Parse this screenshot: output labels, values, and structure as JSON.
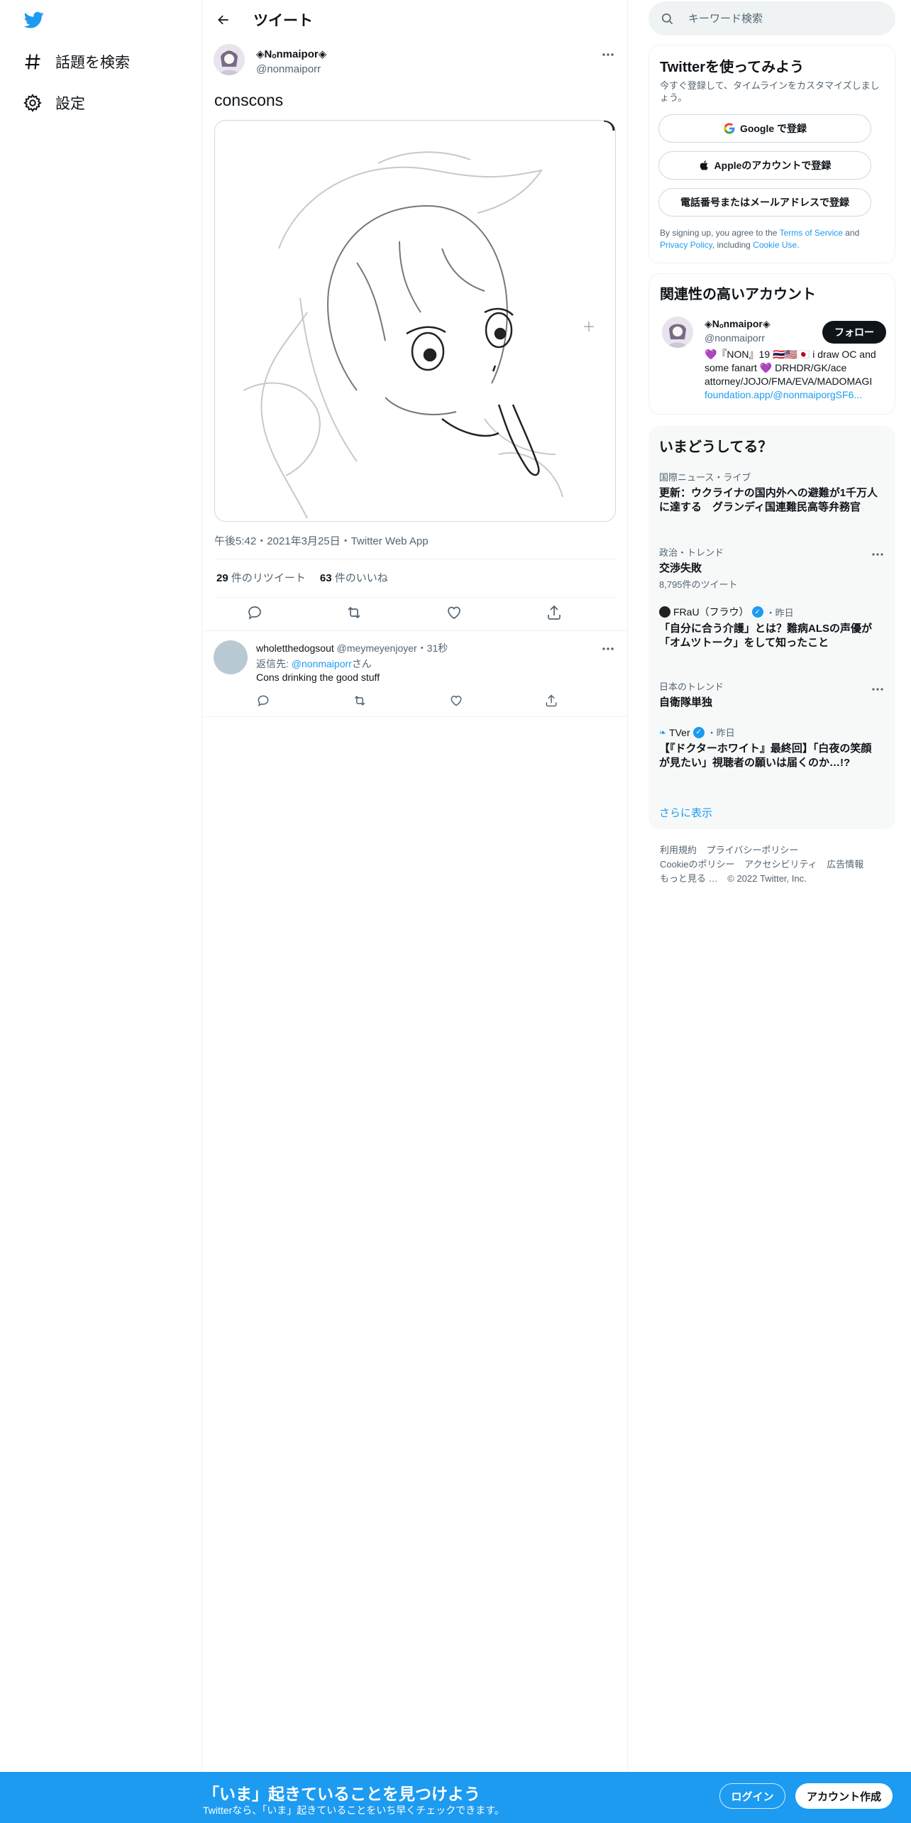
{
  "nav": {
    "logo_icon": "twitter-bird-icon",
    "items": [
      {
        "label": "話題を検索",
        "icon": "hashtag-icon"
      },
      {
        "label": "設定",
        "icon": "gear-icon"
      }
    ]
  },
  "header": {
    "title": "ツイート",
    "back_icon": "arrow-left-icon"
  },
  "tweet": {
    "author_name": "◈Nₒnmaipor◈",
    "author_handle": "@nonmaiporr",
    "text": "conscons",
    "timestamp": "午後5:42・2021年3月25日・Twitter Web App",
    "retweets_count": "29",
    "retweets_label": "件のリツイート",
    "likes_count": "63",
    "likes_label": "件のいいね",
    "media_description_icon": "sketch-illustration"
  },
  "reply": {
    "name": "wholetthedogsout",
    "handle": "@meymeyenjoyer",
    "time": "・31秒",
    "reply_to_prefix": "返信先: ",
    "reply_to_handle": "@nonmaiporr",
    "reply_to_suffix": "さん",
    "text": "Cons drinking the good stuff"
  },
  "search": {
    "placeholder": "キーワード検索"
  },
  "signup": {
    "title": "Twitterを使ってみよう",
    "subtitle": "今すぐ登録して、タイムラインをカスタマイズしましょう。",
    "google_label": "Google で登録",
    "apple_label": "Appleのアカウントで登録",
    "phone_label": "電話番号またはメールアドレスで登録",
    "terms_1": "By signing up, you agree to the ",
    "terms_tos": "Terms of Service",
    "terms_2": " and ",
    "terms_privacy": "Privacy Policy",
    "terms_3": ", including ",
    "terms_cookie": "Cookie Use",
    "terms_4": "."
  },
  "related": {
    "title": "関連性の高いアカウント",
    "name": "◈Nₒnmaipor◈",
    "handle": "@nonmaiporr",
    "follow_label": "フォロー",
    "bio": "💜『NON』19 🇹🇭🇺🇸🇯🇵 i draw OC and some fanart 💜 DRHDR/GK/ace attorney/JOJO/FMA/EVA/MADOMAGI",
    "bio_link": "foundation.app/@nonmaiporgSF6..."
  },
  "trends": {
    "title": "いまどうしてる？",
    "items": [
      {
        "context": "国際ニュース・ライブ",
        "title": "更新：ウクライナの国内外への避難が1千万人に達する　グランディ国連難民高等弁務官"
      },
      {
        "context": "政治・トレンド",
        "title": "交渉失敗",
        "count": "8,795件のツイート"
      },
      {
        "source": "FRaU（フラウ）",
        "time": "・昨日",
        "title": "「自分に合う介護」とは？難病ALSの声優が「オムツトーク」をして知ったこと"
      },
      {
        "context": "日本のトレンド",
        "title": "自衛隊単独"
      },
      {
        "source": "TVer",
        "time": "・昨日",
        "title": "【『ドクターホワイト』最終回】「白夜の笑顔が見たい」視聴者の願いは届くのか…!?"
      }
    ],
    "show_more": "さらに表示"
  },
  "footer": {
    "links": [
      "利用規約",
      "プライバシーポリシー",
      "Cookieのポリシー",
      "アクセシビリティ",
      "広告情報",
      "もっと見る …"
    ],
    "copyright": "© 2022 Twitter, Inc."
  },
  "bottom_bar": {
    "title": "「いま」起きていることを見つけよう",
    "subtitle": "Twitterなら、「いま」起きていることをいち早くチェックできます。",
    "login_label": "ログイン",
    "signup_label": "アカウント作成"
  },
  "colors": {
    "accent": "#1d9bf0",
    "text": "#0f1419",
    "muted": "#536471",
    "border": "#eff3f4"
  }
}
